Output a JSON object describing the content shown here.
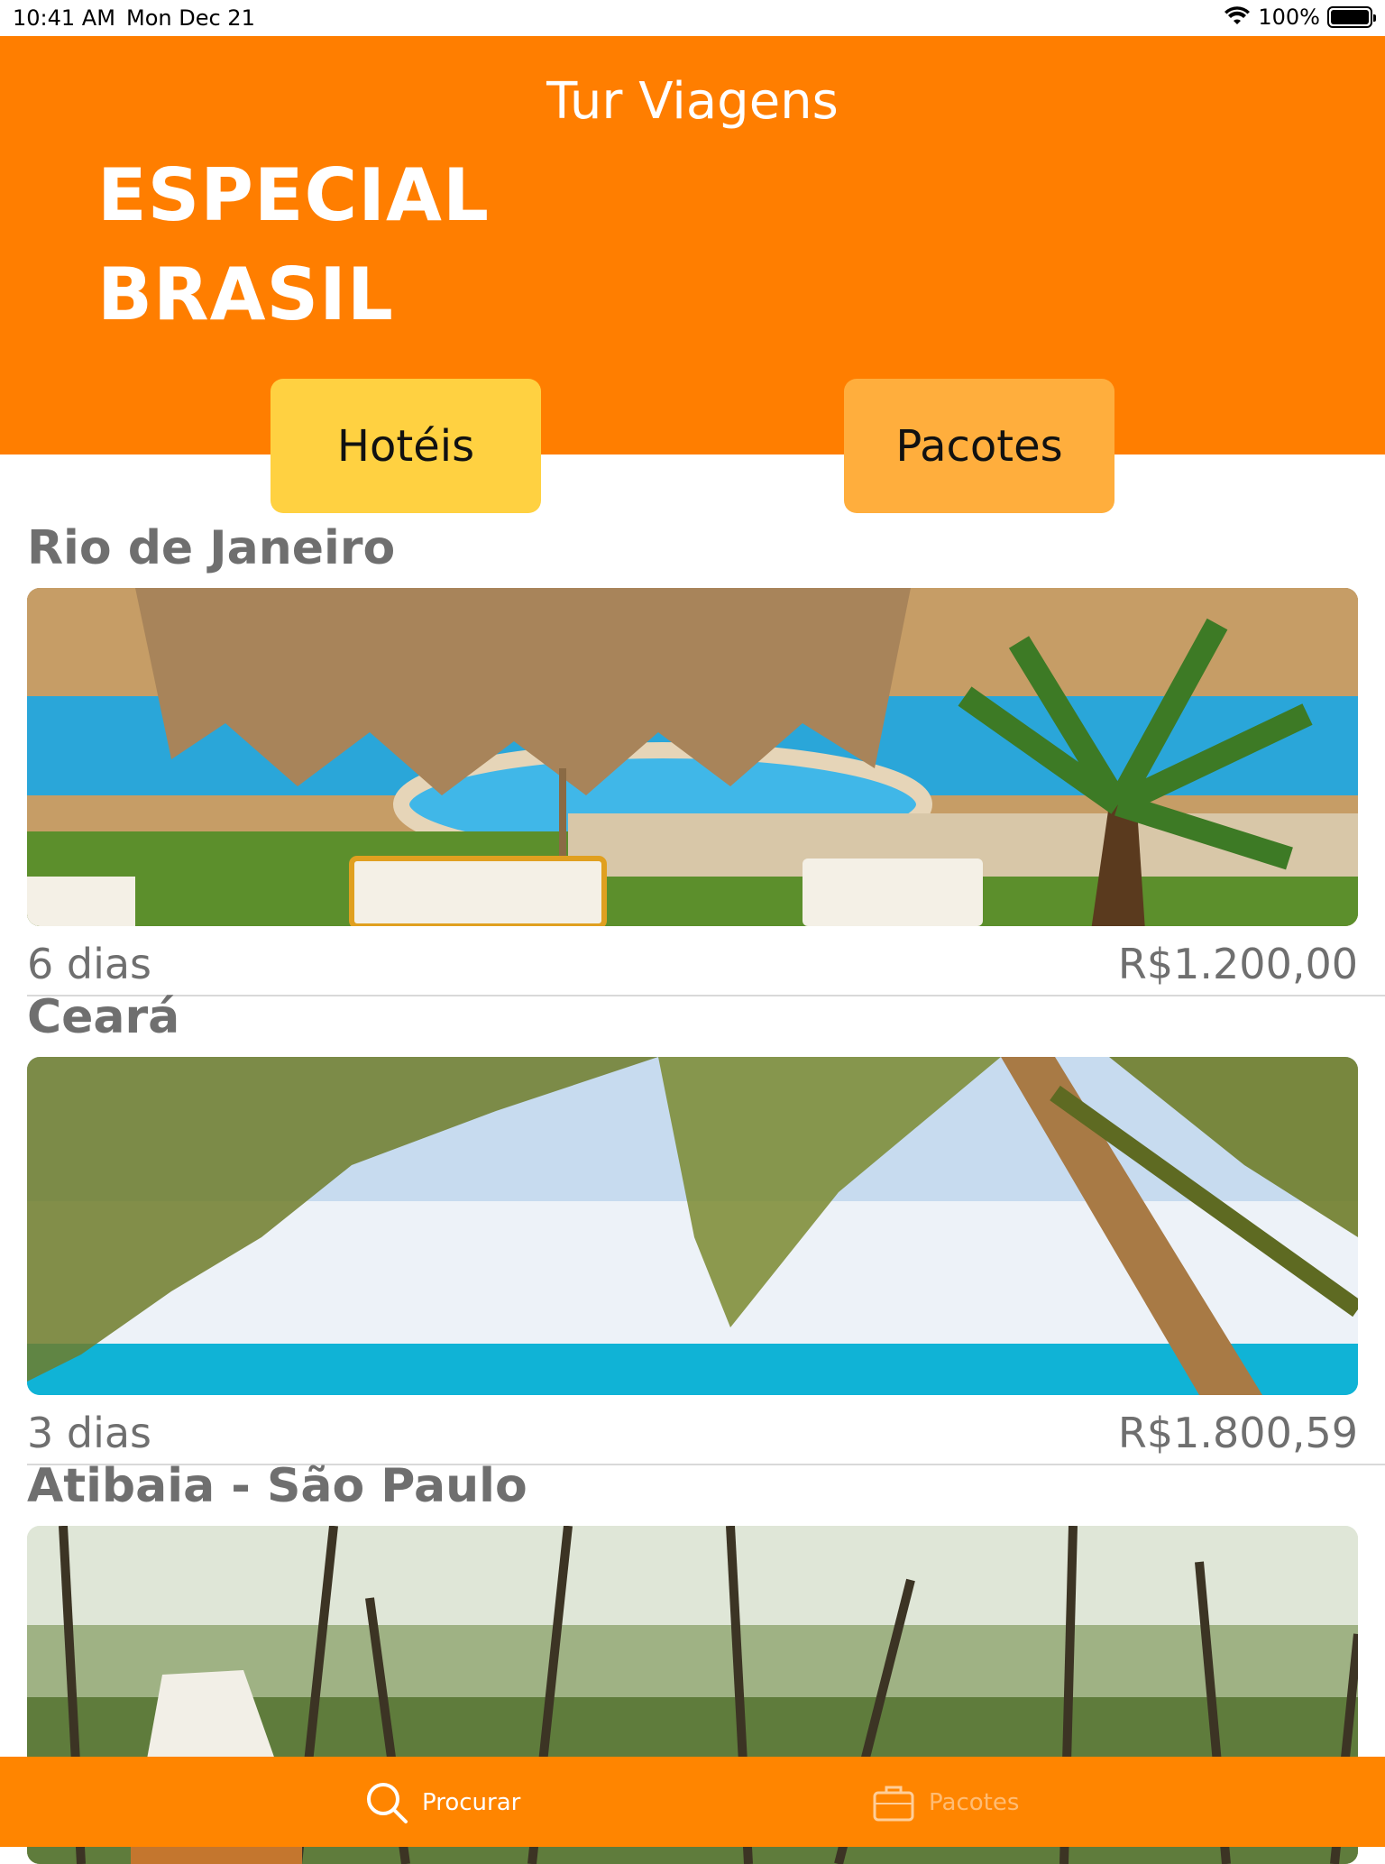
{
  "status_bar": {
    "time": "10:41 AM",
    "date": "Mon Dec 21",
    "battery": "100%"
  },
  "header": {
    "title": "Tur Viagens",
    "banner_line1": "ESPECIAL",
    "banner_line2": "BRASIL",
    "bg_color": "#FF7E00"
  },
  "segments": {
    "hoteis": "Hotéis",
    "pacotes": "Pacotes"
  },
  "listings": [
    {
      "name": "Rio de Janeiro",
      "days": "6 dias",
      "price": "R$1.200,00"
    },
    {
      "name": "Ceará",
      "days": "3 dias",
      "price": "R$1.800,59"
    },
    {
      "name": "Atibaia - São Paulo",
      "days": "",
      "price": ""
    }
  ],
  "tab_bar": {
    "items": [
      {
        "label": "Procurar",
        "icon": "search-icon"
      },
      {
        "label": "Pacotes",
        "icon": "suitcase-icon"
      }
    ]
  }
}
